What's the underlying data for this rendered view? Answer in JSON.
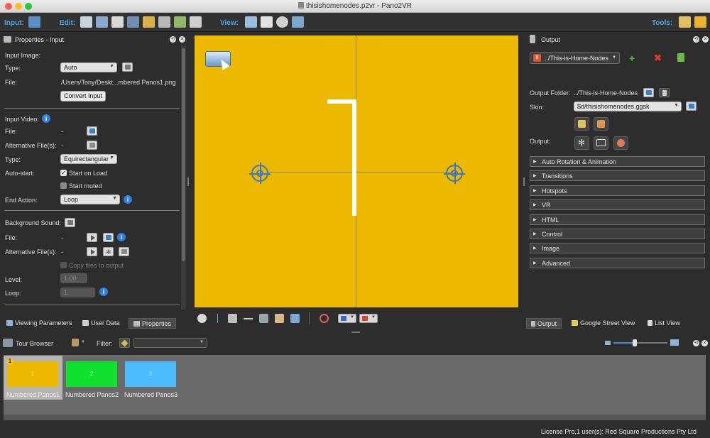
{
  "window": {
    "title": "thisishomenodes.p2vr - Pano2VR"
  },
  "toolbar": {
    "input_label": "Input:",
    "edit_label": "Edit:",
    "view_label": "View:",
    "tools_label": "Tools:"
  },
  "properties": {
    "header": "Properties - Input",
    "input_image_label": "Input Image:",
    "type_label": "Type:",
    "type_value": "Auto",
    "file_label": "File:",
    "file_value": "/Users/Tony/Deskt...mbered Panos1.png",
    "convert_button": "Convert Input",
    "input_video_label": "Input Video:",
    "video_file_label": "File:",
    "video_file_value": "-",
    "video_alt_label": "Alternative File(s):",
    "video_alt_value": "-",
    "video_type_label": "Type:",
    "video_type_value": "Equirectangular",
    "autostart_label": "Auto-start:",
    "start_on_load_label": "Start on Load",
    "start_on_load_checked": true,
    "start_muted_label": "Start muted",
    "start_muted_checked": false,
    "end_action_label": "End Action:",
    "end_action_value": "Loop",
    "bg_sound_label": "Background Sound:",
    "sound_file_label": "File:",
    "sound_file_value": "-",
    "sound_alt_label": "Alternative File(s):",
    "sound_alt_value": "-",
    "copy_files_label": "Copy files to output",
    "level_label": "Level:",
    "level_value": "1.00",
    "loop_label": "Loop:",
    "loop_value": "1"
  },
  "left_tabs": [
    {
      "label": "Viewing Parameters",
      "active": false
    },
    {
      "label": "User Data",
      "active": false
    },
    {
      "label": "Properties",
      "active": true
    }
  ],
  "output": {
    "header": "Output",
    "format_value": "../This-is-Home-Nodes",
    "output_folder_label": "Output Folder:",
    "output_folder_value": "../This-is-Home-Nodes",
    "skin_label": "Skin:",
    "skin_value": "$d/thisishomenodes.ggsk",
    "output_label": "Output:",
    "sections": [
      "Auto Rotation & Animation",
      "Transitions",
      "Hotspots",
      "VR",
      "HTML",
      "Control",
      "Image",
      "Advanced"
    ]
  },
  "right_tabs": [
    {
      "label": "Output",
      "active": true
    },
    {
      "label": "Google Street View",
      "active": false
    },
    {
      "label": "List View",
      "active": false
    }
  ],
  "tour_browser": {
    "title": "Tour Browser",
    "filter_label": "Filter:",
    "filter_value": "",
    "panos": [
      {
        "number": "1",
        "caption": "Numbered Panos1",
        "color": "#ecb800",
        "selected": true,
        "badge": "1"
      },
      {
        "number": "2",
        "caption": "Numbered Panos2",
        "color": "#11e02e",
        "selected": false
      },
      {
        "number": "3",
        "caption": "Numbered Panos3",
        "color": "#4dbcff",
        "selected": false
      }
    ]
  },
  "status": {
    "license": "License Pro,1 user(s): Red Square Productions Pty Ltd"
  },
  "colors": {
    "accent": "#4aa3e8",
    "viewer_bg": "#ecb800",
    "panel_bg": "#2d2d2d"
  }
}
